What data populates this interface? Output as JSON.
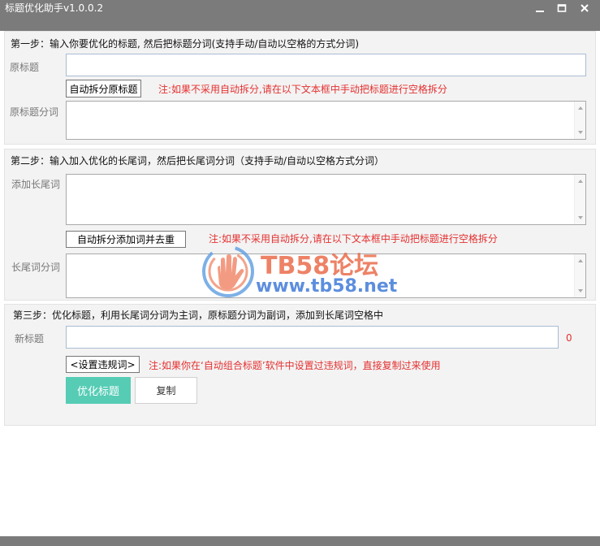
{
  "window": {
    "title": "标题优化助手v1.0.0.2"
  },
  "step1": {
    "heading": "第一步：输入你要优化的标题, 然后把标题分词(支持手动/自动以空格的方式分词)",
    "original_title_label": "原标题",
    "original_title_value": "",
    "split_button_label": "自动拆分原标题",
    "note": "注:如果不采用自动拆分,请在以下文本框中手动把标题进行空格拆分",
    "segment_label": "原标题分词",
    "segment_value": ""
  },
  "step2": {
    "heading": "第二步：输入加入优化的长尾词，然后把长尾词分词（支持手动/自动以空格方式分词）",
    "add_label": "添加长尾词",
    "add_value": "",
    "split_button_label": "自动拆分添加词并去重",
    "note": "注:如果不采用自动拆分,请在以下文本框中手动把标题进行空格拆分",
    "segment_label": "长尾词分词",
    "segment_value": ""
  },
  "step3": {
    "heading": "第三步：优化标题，利用长尾词分词为主词，原标题分词为副词，添加到长尾词空格中",
    "new_title_label": "新标题",
    "new_title_value": "",
    "char_count": "0",
    "rules_button_label": "<设置违规词>",
    "note": "注:如果你在‘自动组合标题’软件中设置过违规词，直接复制过来使用",
    "optimize_button_label": "优化标题",
    "copy_button_label": "复制"
  },
  "watermark": {
    "line1": "TB58论坛",
    "line2": "www.tb58.net"
  },
  "colors": {
    "titlebar": "#7b7b7b",
    "note_red": "#e53131",
    "primary_button": "#56ccb5",
    "watermark_red": "#e8603c",
    "watermark_blue": "#2f6fd6"
  },
  "icons": {
    "minimize": "minimize-icon",
    "maximize": "maximize-icon",
    "close": "close-icon",
    "logo": "hand-logo-icon"
  }
}
